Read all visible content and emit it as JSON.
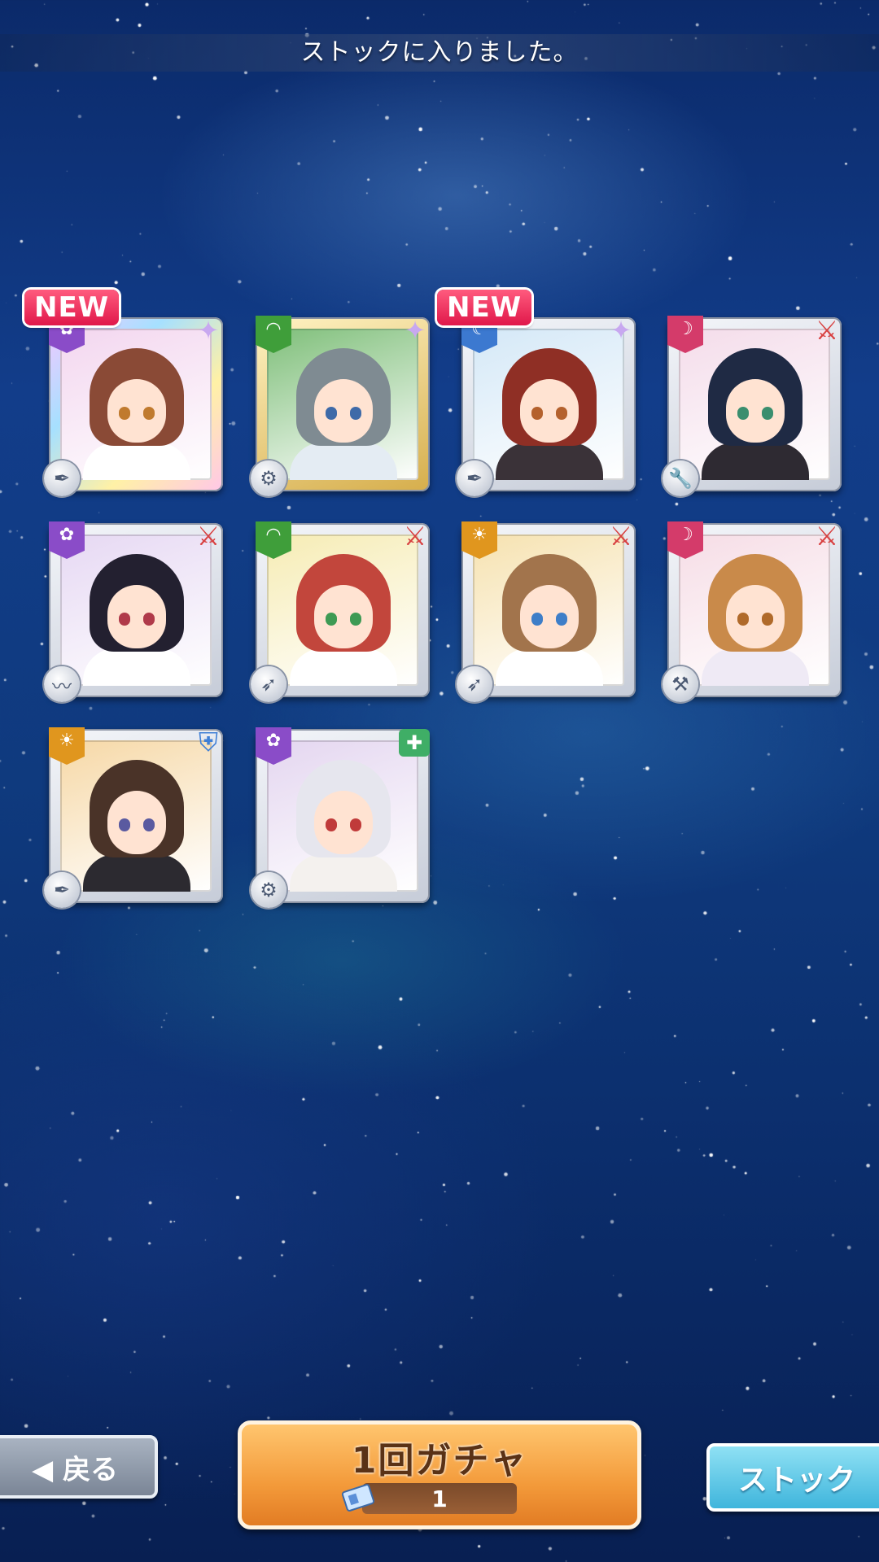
{
  "header": {
    "message": "ストックに入りました。"
  },
  "cards": [
    {
      "attribute_color": "#8a4cc8",
      "attribute_icon": "flower",
      "role_icon": "star",
      "weapon_icon": "quill",
      "is_new": true,
      "frame": "rainbow",
      "hair_color": "#8a4a36",
      "eye_color": "#c07a2e",
      "outfit_color": "#ffffff",
      "bg_color": "#f3d6ef"
    },
    {
      "attribute_color": "#3f9e3a",
      "attribute_icon": "wave",
      "role_icon": "star",
      "weapon_icon": "gear",
      "is_new": false,
      "frame": "gold",
      "hair_color": "#7f8b92",
      "eye_color": "#3e6aa8",
      "outfit_color": "#e4ecf3",
      "bg_color": "#7fbf7a"
    },
    {
      "attribute_color": "#3c79d0",
      "attribute_icon": "moon",
      "role_icon": "star",
      "weapon_icon": "quill",
      "is_new": true,
      "frame": "silver",
      "hair_color": "#8f2f25",
      "eye_color": "#b4612d",
      "outfit_color": "#3a3238",
      "bg_color": "#d4e8f7"
    },
    {
      "attribute_color": "#d43b6a",
      "attribute_icon": "crescent",
      "role_icon": "sword",
      "weapon_icon": "wrench",
      "is_new": false,
      "frame": "silver",
      "hair_color": "#1f2a44",
      "eye_color": "#3a8e6e",
      "outfit_color": "#2e2a32",
      "bg_color": "#f4dcea"
    },
    {
      "attribute_color": "#8a4cc8",
      "attribute_icon": "flower",
      "role_icon": "sword",
      "weapon_icon": "whip",
      "is_new": false,
      "frame": "silver",
      "hair_color": "#232030",
      "eye_color": "#b03a4a",
      "outfit_color": "#ffffff",
      "bg_color": "#e6d8f3"
    },
    {
      "attribute_color": "#3f9e3a",
      "attribute_icon": "wave",
      "role_icon": "sword",
      "weapon_icon": "rocket",
      "is_new": false,
      "frame": "silver",
      "hair_color": "#c2463c",
      "eye_color": "#3e9a54",
      "outfit_color": "#ffffff",
      "bg_color": "#f6ecb4"
    },
    {
      "attribute_color": "#e0961e",
      "attribute_icon": "sun",
      "role_icon": "sword",
      "weapon_icon": "rocket",
      "is_new": false,
      "frame": "silver",
      "hair_color": "#a2744c",
      "eye_color": "#3e7ec8",
      "outfit_color": "#ffffff",
      "bg_color": "#f6e2b0"
    },
    {
      "attribute_color": "#d43b6a",
      "attribute_icon": "crescent",
      "role_icon": "sword",
      "weapon_icon": "hammer",
      "is_new": false,
      "frame": "silver",
      "hair_color": "#c98a4a",
      "eye_color": "#b06a2a",
      "outfit_color": "#efeaf5",
      "bg_color": "#f6dde6"
    },
    {
      "attribute_color": "#e0961e",
      "attribute_icon": "sun",
      "role_icon": "shield",
      "weapon_icon": "quill",
      "is_new": false,
      "frame": "silver",
      "hair_color": "#4a3328",
      "eye_color": "#5a5aa0",
      "outfit_color": "#2c2a30",
      "bg_color": "#f6d8a6"
    },
    {
      "attribute_color": "#8a4cc8",
      "attribute_icon": "flower",
      "role_icon": "medkit",
      "weapon_icon": "gear",
      "is_new": false,
      "frame": "silver",
      "hair_color": "#e6e6ee",
      "eye_color": "#c03a3a",
      "outfit_color": "#f4f1ee",
      "bg_color": "#e4d6f0"
    }
  ],
  "new_badge_label": "NEW",
  "buttons": {
    "back_label": "◀ 戻る",
    "gacha_label": "1回ガチャ",
    "gacha_cost": "1",
    "stock_label": "ストック"
  },
  "colors": {
    "role_star": "#c8a8f0",
    "role_sword": "#d84040",
    "role_shield": "#3f7fd6",
    "role_medkit": "#3fae66"
  }
}
